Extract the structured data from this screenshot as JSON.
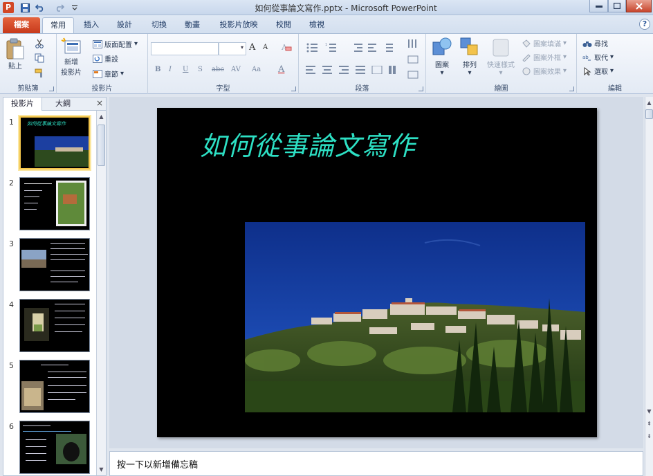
{
  "window": {
    "title": "如何從事論文寫作.pptx - Microsoft PowerPoint",
    "app_icon_letter": "P",
    "help_glyph": "?"
  },
  "qat": {
    "icons": [
      "save-icon",
      "undo-icon",
      "redo-icon",
      "customize-qat-icon"
    ]
  },
  "tabs": {
    "file": "檔案",
    "home": "常用",
    "insert": "插入",
    "design": "設計",
    "transitions": "切換",
    "animations": "動畫",
    "slideshow": "投影片放映",
    "review": "校閱",
    "view": "檢視"
  },
  "ribbon": {
    "clipboard": {
      "label": "剪貼簿",
      "paste": "貼上"
    },
    "slides": {
      "label": "投影片",
      "new_slide_1": "新增",
      "new_slide_2": "投影片",
      "layout": "版面配置",
      "reset": "重設",
      "section": "章節"
    },
    "font": {
      "label": "字型",
      "grow": "A",
      "shrink": "A",
      "bold": "B",
      "italic": "I",
      "underline": "U",
      "strike": "S",
      "shadow": "abc",
      "spacing": "AV",
      "case": "Aa",
      "color": "A"
    },
    "paragraph": {
      "label": "段落"
    },
    "drawing": {
      "label": "繪圖",
      "shapes": "圖案",
      "arrange": "排列",
      "quick_styles": "快速樣式",
      "fill": "圖案填滿",
      "outline": "圖案外框",
      "effects": "圖案效果"
    },
    "editing": {
      "label": "編輯",
      "find": "尋找",
      "replace": "取代",
      "select": "選取"
    }
  },
  "left_panel": {
    "tab_slides": "投影片",
    "tab_outline": "大綱",
    "close": "×"
  },
  "thumbnails": [
    {
      "num": "1",
      "selected": true,
      "title": "如何從事論文寫作"
    },
    {
      "num": "2",
      "selected": false
    },
    {
      "num": "3",
      "selected": false
    },
    {
      "num": "4",
      "selected": false
    },
    {
      "num": "5",
      "selected": false
    },
    {
      "num": "6",
      "selected": false
    }
  ],
  "slide": {
    "title": "如何從事論文寫作",
    "title_color": "#2de0c4",
    "background": "#000000"
  },
  "notes": {
    "placeholder": "按一下以新增備忘稿"
  },
  "colors": {
    "file_tab": "#d24726",
    "ribbon_bg": "#e3eaf4",
    "selection": "#f2c44a"
  }
}
